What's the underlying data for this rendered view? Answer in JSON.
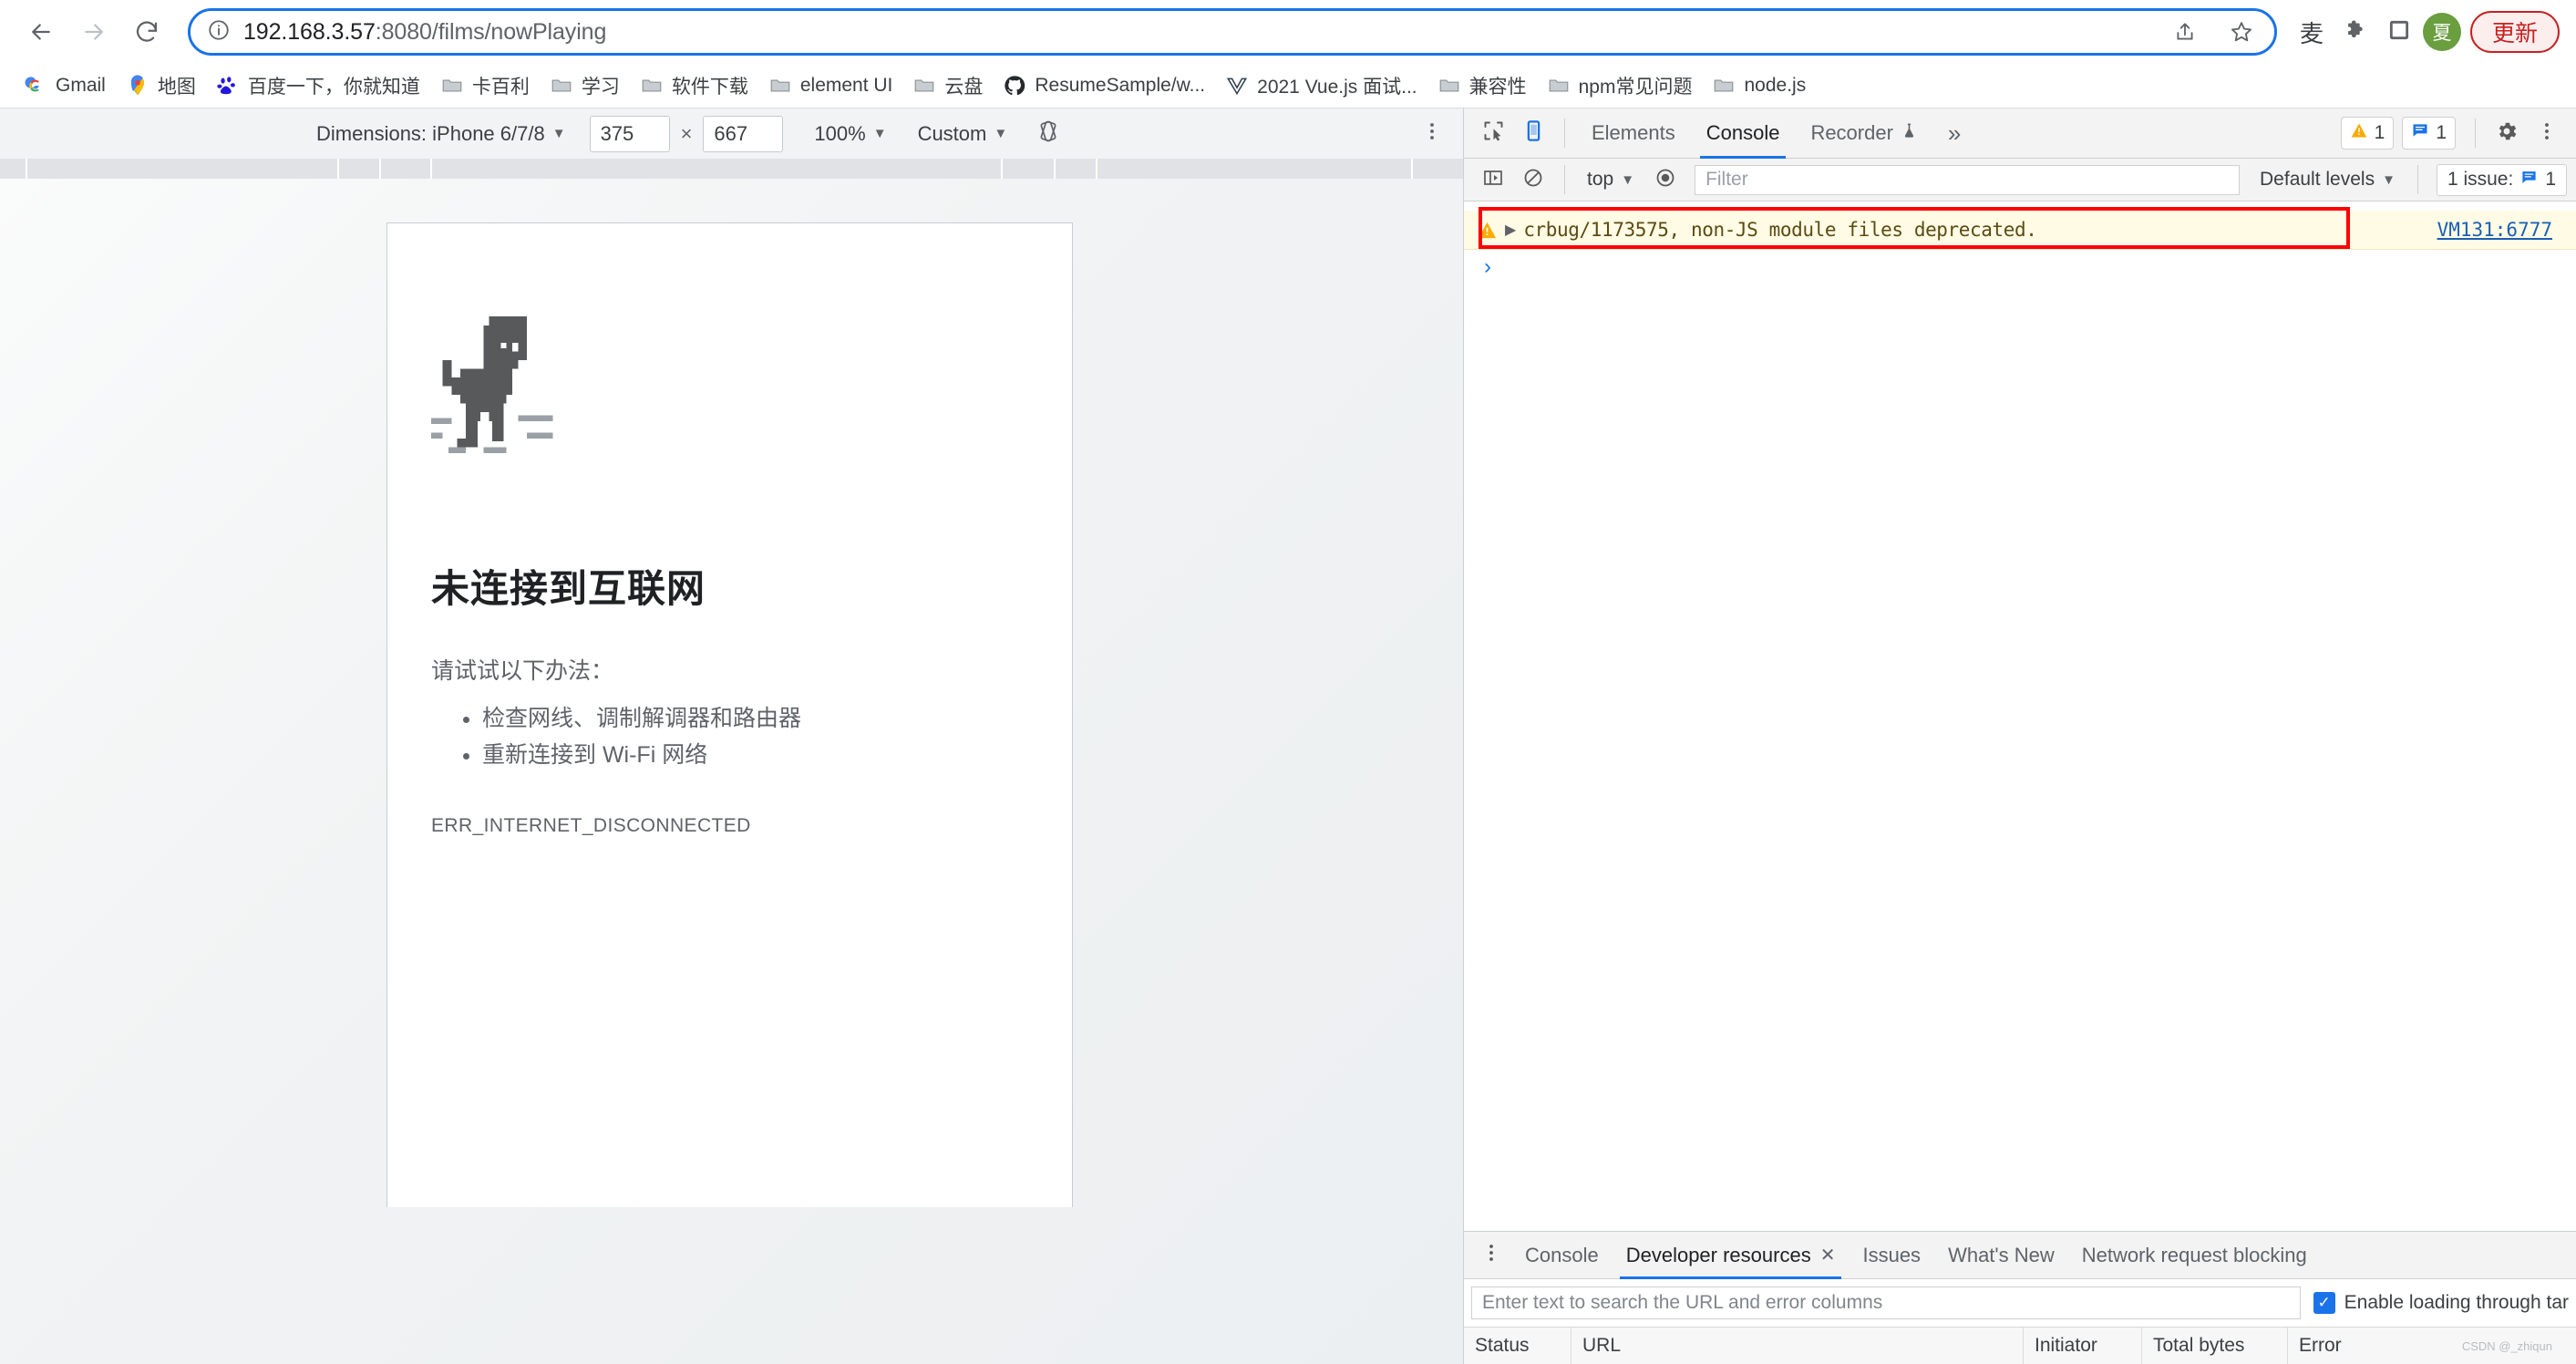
{
  "browser": {
    "back_icon": "back-arrow-icon",
    "forward_icon": "forward-arrow-icon",
    "reload_icon": "reload-icon",
    "site_info_icon": "info-circle-icon",
    "url_host": "192.168.3.57",
    "url_rest": ":8080/films/nowPlaying",
    "share_icon": "share-icon",
    "bookmark_icon": "star-icon",
    "extension_a": "麦",
    "puzzle_icon": "puzzle-piece-icon",
    "sidepanel_icon": "side-panel-icon",
    "avatar_label": "夏",
    "update_label": "更新"
  },
  "bookmarks": [
    {
      "label": "Gmail",
      "icon": "gmail-icon"
    },
    {
      "label": "地图",
      "icon": "maps-pin-icon"
    },
    {
      "label": "百度一下，你就知道",
      "icon": "baidu-icon"
    },
    {
      "label": "卡百利",
      "icon": "folder-icon"
    },
    {
      "label": "学习",
      "icon": "folder-icon"
    },
    {
      "label": "软件下载",
      "icon": "folder-icon"
    },
    {
      "label": "element UI",
      "icon": "folder-icon"
    },
    {
      "label": "云盘",
      "icon": "folder-icon"
    },
    {
      "label": "ResumeSample/w...",
      "icon": "github-icon"
    },
    {
      "label": "2021 Vue.js 面试...",
      "icon": "vue-icon"
    },
    {
      "label": "兼容性",
      "icon": "folder-icon"
    },
    {
      "label": "npm常见问题",
      "icon": "folder-icon"
    },
    {
      "label": "node.js",
      "icon": "folder-icon"
    }
  ],
  "device_toolbar": {
    "dimensions_label": "Dimensions: iPhone 6/7/8",
    "width_value": "375",
    "times": "×",
    "height_value": "667",
    "zoom_value": "100%",
    "throttle_value": "Custom",
    "rotate_icon": "rotate-device-icon",
    "more_icon": "more-vertical-icon"
  },
  "page": {
    "dino_icon": "dinosaur-icon",
    "heading": "未连接到互联网",
    "subheading": "请试试以下办法：",
    "suggestions": [
      "检查网线、调制解调器和路由器",
      "重新连接到 Wi-Fi 网络"
    ],
    "error_code": "ERR_INTERNET_DISCONNECTED"
  },
  "devtools": {
    "inspect_icon": "inspect-element-icon",
    "device_toggle_icon": "device-toolbar-icon",
    "tabs": [
      {
        "label": "Elements",
        "active": false
      },
      {
        "label": "Console",
        "active": true
      },
      {
        "label": "Recorder",
        "active": false,
        "badge_icon": "flask-icon"
      }
    ],
    "more_tabs_icon": "chevron-double-right-icon",
    "warning_count": "1",
    "issue_count": "1",
    "settings_icon": "gear-icon",
    "more_icon": "more-vertical-icon"
  },
  "console_toolbar": {
    "sidebar_icon": "console-sidebar-icon",
    "clear_icon": "clear-console-icon",
    "context_value": "top",
    "eye_icon": "live-expression-icon",
    "filter_placeholder": "Filter",
    "levels_value": "Default levels",
    "issues_label": "1 issue:",
    "issues_badge_icon": "issue-icon",
    "issues_count": "1"
  },
  "console_messages": [
    {
      "icon": "warning-triangle-icon",
      "expand_icon": "triangle-right-icon",
      "text": "crbug/1173575, non-JS module files deprecated.",
      "source": "VM131:6777"
    }
  ],
  "console_prompt": "›",
  "drawer": {
    "more_icon": "more-vertical-icon",
    "tabs": [
      {
        "label": "Console",
        "active": false,
        "closable": false
      },
      {
        "label": "Developer resources",
        "active": true,
        "closable": true
      },
      {
        "label": "Issues",
        "active": false,
        "closable": false
      },
      {
        "label": "What's New",
        "active": false,
        "closable": false
      },
      {
        "label": "Network request blocking",
        "active": false,
        "closable": false
      }
    ],
    "close_glyph": "✕",
    "search_placeholder": "Enter text to search the URL and error columns",
    "enable_loading_label": "Enable loading through tar",
    "checkbox_checked": true,
    "check_glyph": "✓",
    "columns": [
      "Status",
      "URL",
      "Initiator",
      "Total bytes",
      "Error"
    ],
    "watermark": "CSDN @_zhiqun"
  },
  "colors": {
    "accent": "#1a73e8",
    "warning_bg": "#fffbe5",
    "warning_text": "#5c4a12",
    "highlight_box": "#ff0000",
    "update_red": "#c5221f",
    "avatar_green": "#6a9e3f"
  }
}
